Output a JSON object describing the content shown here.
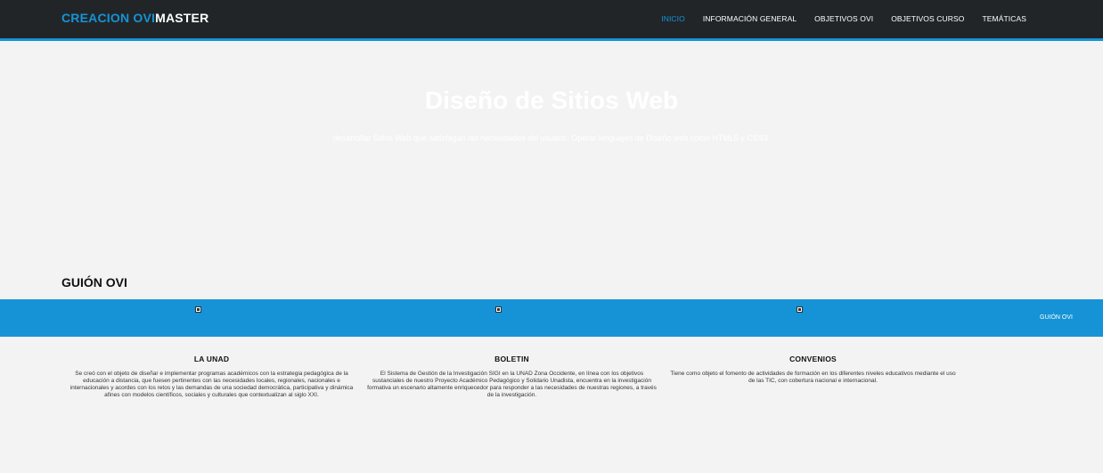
{
  "header": {
    "logo_part1": "CREACION OVI",
    "logo_part2": "MASTER",
    "nav": [
      {
        "label": "INICIO"
      },
      {
        "label": "INFORMACIÓN GENERAL"
      },
      {
        "label": "OBJETIVOS OVI"
      },
      {
        "label": "OBJETIVOS CURSO"
      },
      {
        "label": "TEMÁTICAS"
      }
    ],
    "active_index": 0
  },
  "hero": {
    "title": "Diseño de Sitios Web",
    "subtitle": "desarrollar Sitios Web que satisfagan las necesidades del usuario. Operar lenguajes de Diseño web como HTML5 y CSS3."
  },
  "section": {
    "title": "GUIÓN OVI"
  },
  "band": {
    "link_label": "GUIÓN OVI",
    "images": [
      "broken-image-icon",
      "broken-image-icon",
      "broken-image-icon"
    ]
  },
  "columns": [
    {
      "title": "LA UNAD",
      "text": "Se creó con el objeto de diseñar e implementar programas académicos con la estrategia pedagógica de la educación a distancia, que fuesen pertinentes con las necesidades locales, regionales, nacionales e internacionales y acordes con los retos y las demandas de una sociedad democrática, participativa y dinámica afines con modelos científicos, sociales y culturales que contextualizan al siglo XXI."
    },
    {
      "title": "BOLETIN",
      "text": "El Sistema de Gestión de la Investigación SIGI en la UNAD Zona Occidente, en línea con los objetivos sustanciales de nuestro Proyecto Académico Pedagógico y Solidario Unadista, encuentra en la investigación formativa un escenario altamente enriquecedor para responder a las necesidades de nuestras regiones, a través de la investigación."
    },
    {
      "title": "CONVENIOS",
      "text": "Tiene como objeto el fomento de actividades de formación en los diferentes niveles educativos mediante el uso de las TIC, con cobertura nacional e internacional."
    }
  ],
  "colors": {
    "accent": "#1593d6",
    "topbar": "#222528",
    "background": "#f3f3f3"
  }
}
